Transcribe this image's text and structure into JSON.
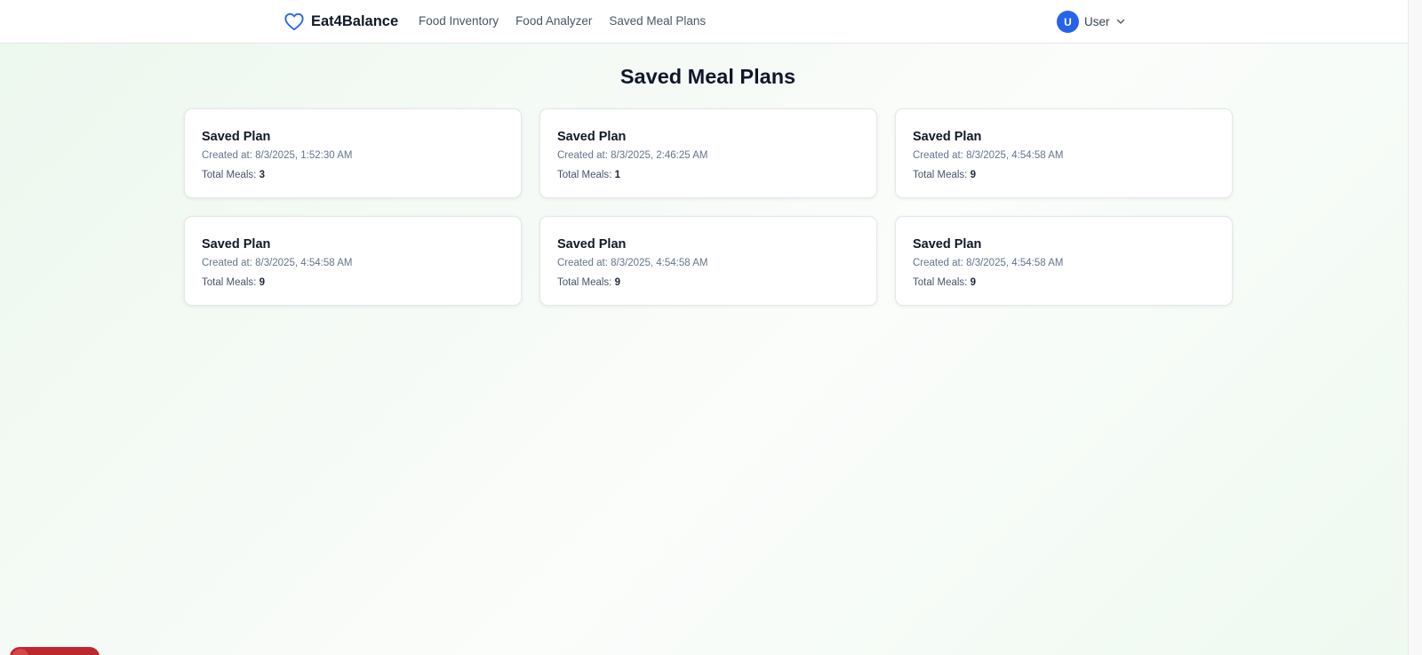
{
  "header": {
    "brand": {
      "name": "Eat4Balance",
      "icon": "heart-icon",
      "icon_color": "#2563eb"
    },
    "nav": [
      {
        "label": "Food Inventory"
      },
      {
        "label": "Food Analyzer"
      },
      {
        "label": "Saved Meal Plans"
      }
    ],
    "user": {
      "initial": "U",
      "name": "User",
      "avatar_color": "#2563eb",
      "menu_icon": "chevron-down-icon"
    }
  },
  "main": {
    "title": "Saved Meal Plans",
    "plans": [
      {
        "title": "Saved Plan",
        "created_label": "Created at:",
        "created_at": "8/3/2025, 1:52:30 AM",
        "meals_label": "Total Meals:",
        "meals": "3"
      },
      {
        "title": "Saved Plan",
        "created_label": "Created at:",
        "created_at": "8/3/2025, 2:46:25 AM",
        "meals_label": "Total Meals:",
        "meals": "1"
      },
      {
        "title": "Saved Plan",
        "created_label": "Created at:",
        "created_at": "8/3/2025, 4:54:58 AM",
        "meals_label": "Total Meals:",
        "meals": "9"
      },
      {
        "title": "Saved Plan",
        "created_label": "Created at:",
        "created_at": "8/3/2025, 4:54:58 AM",
        "meals_label": "Total Meals:",
        "meals": "9"
      },
      {
        "title": "Saved Plan",
        "created_label": "Created at:",
        "created_at": "8/3/2025, 4:54:58 AM",
        "meals_label": "Total Meals:",
        "meals": "9"
      },
      {
        "title": "Saved Plan",
        "created_label": "Created at:",
        "created_at": "8/3/2025, 4:54:58 AM",
        "meals_label": "Total Meals:",
        "meals": "9"
      }
    ]
  },
  "colors": {
    "accent": "#2563eb",
    "background_tint": "#ecf8ee",
    "floating_widget": "#c0262d"
  }
}
